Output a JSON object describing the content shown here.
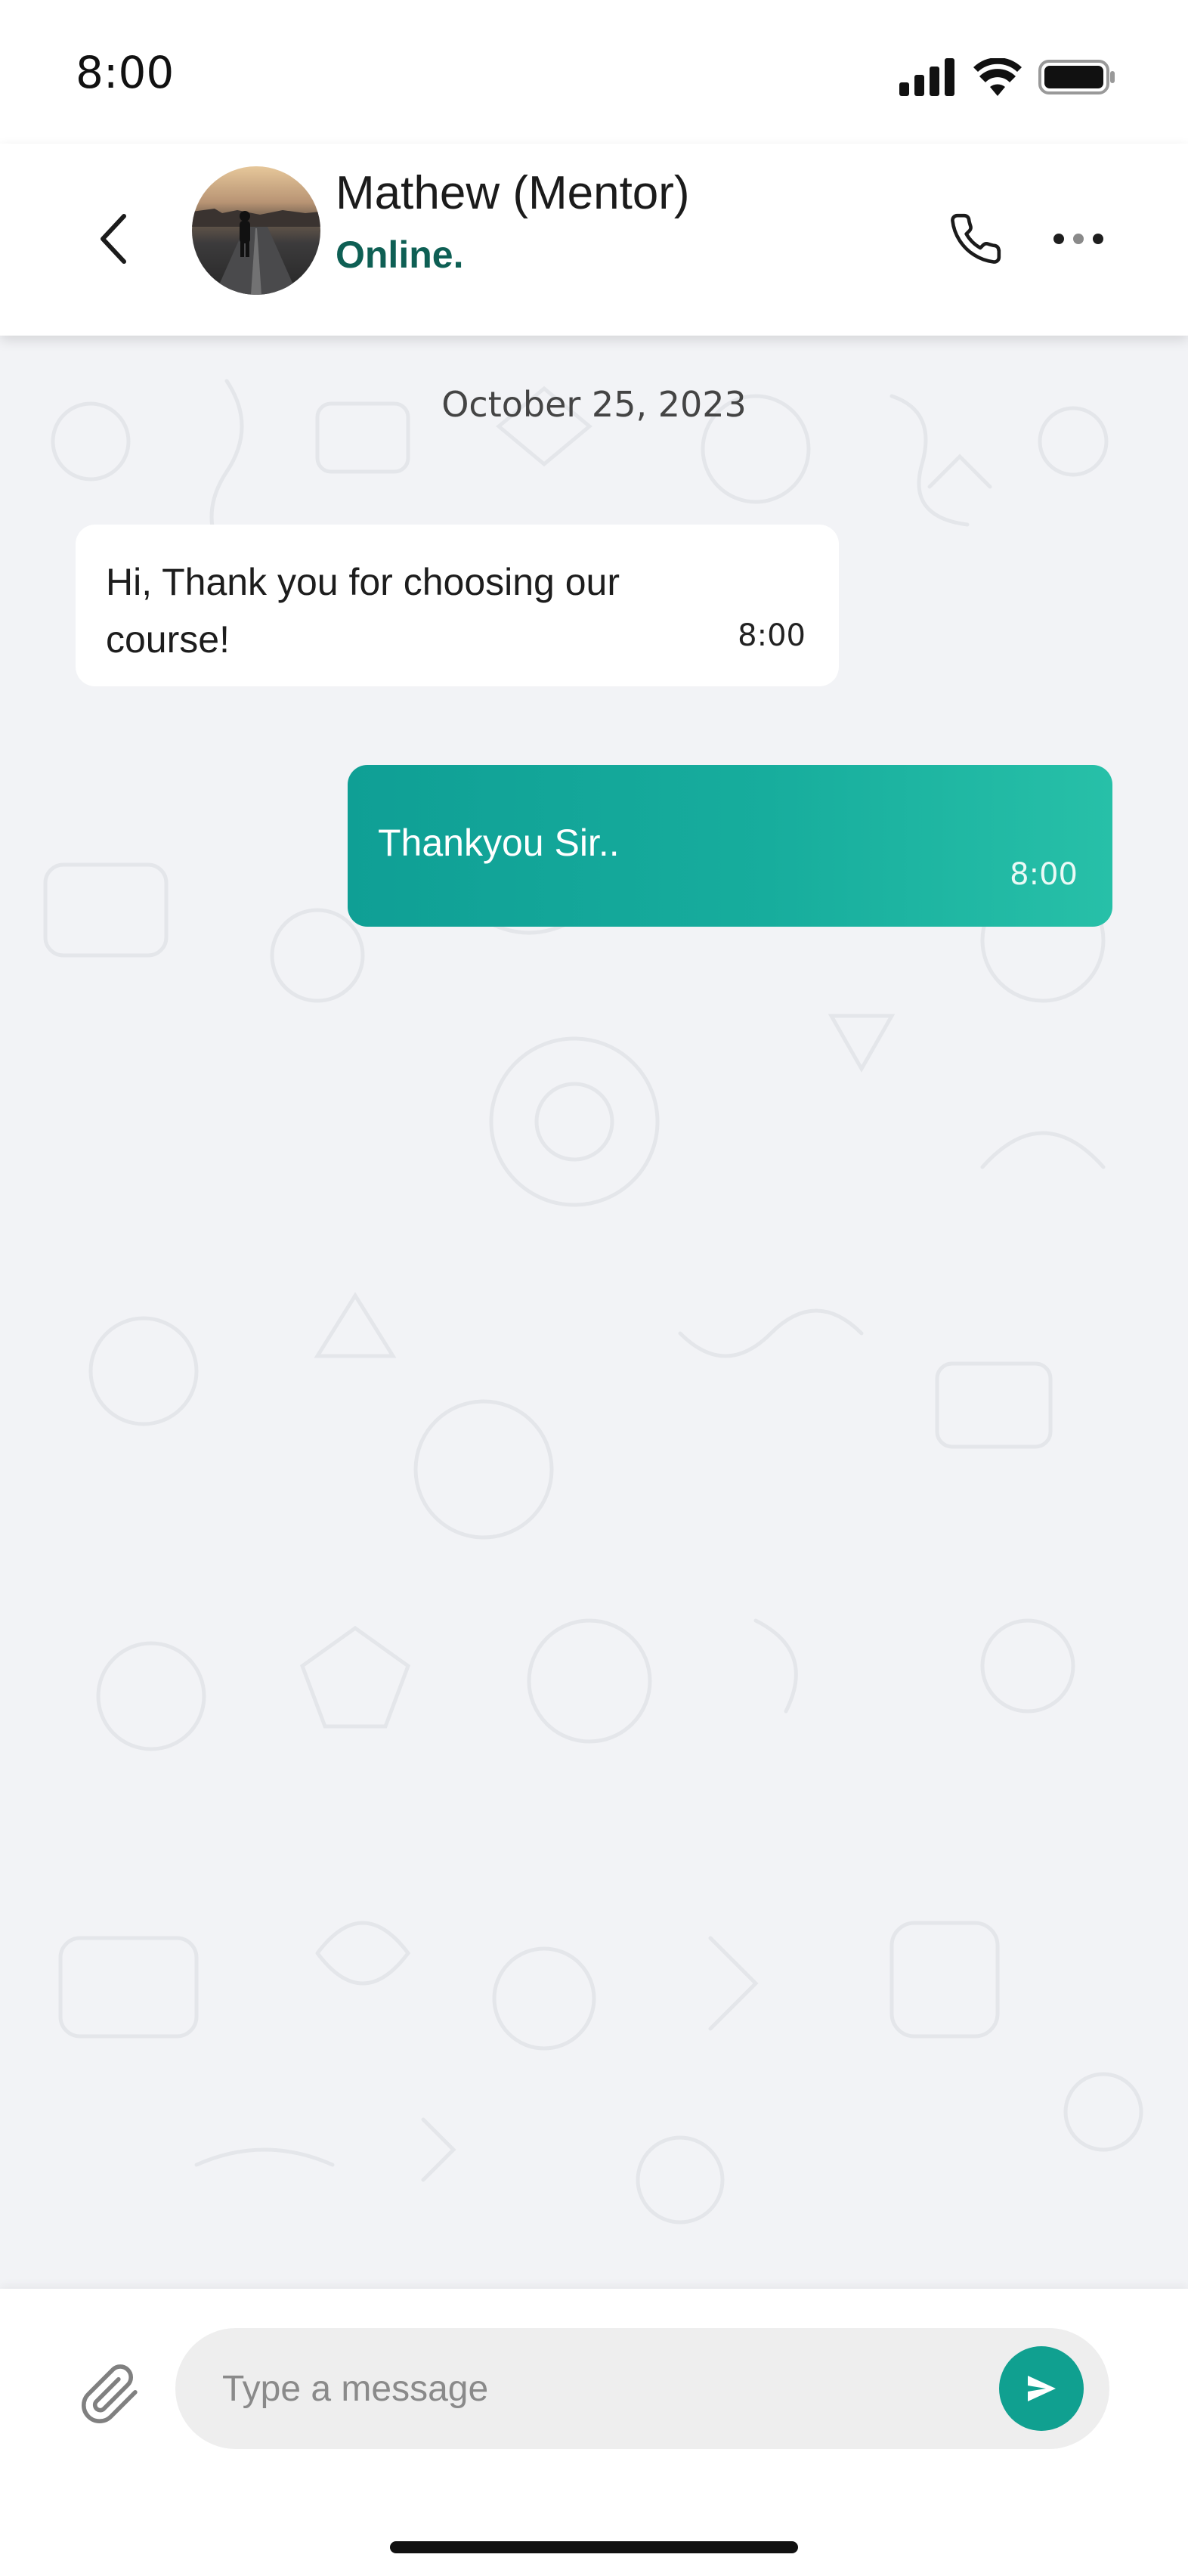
{
  "status_bar": {
    "time": "8:00",
    "icons": [
      "cellular-signal-icon",
      "wifi-icon",
      "battery-icon"
    ]
  },
  "header": {
    "back_icon": "chevron-left-icon",
    "contact_name": "Mathew (Mentor)",
    "contact_status": "Online.",
    "status_color": "#0e5f54",
    "call_icon": "phone-icon",
    "more_icon": "more-horizontal-icon"
  },
  "chat": {
    "date": "October 25, 2023",
    "messages": [
      {
        "direction": "incoming",
        "text": "Hi, Thank you for choosing our course!",
        "time": "8:00"
      },
      {
        "direction": "outgoing",
        "text": "Thankyou Sir..",
        "time": "8:00"
      }
    ],
    "outgoing_bubble_colors": [
      "#0f9f95",
      "#27c0a8"
    ]
  },
  "composer": {
    "attach_icon": "paperclip-icon",
    "placeholder": "Type a message",
    "value": "",
    "send_icon": "send-icon",
    "accent": "#10a090"
  }
}
